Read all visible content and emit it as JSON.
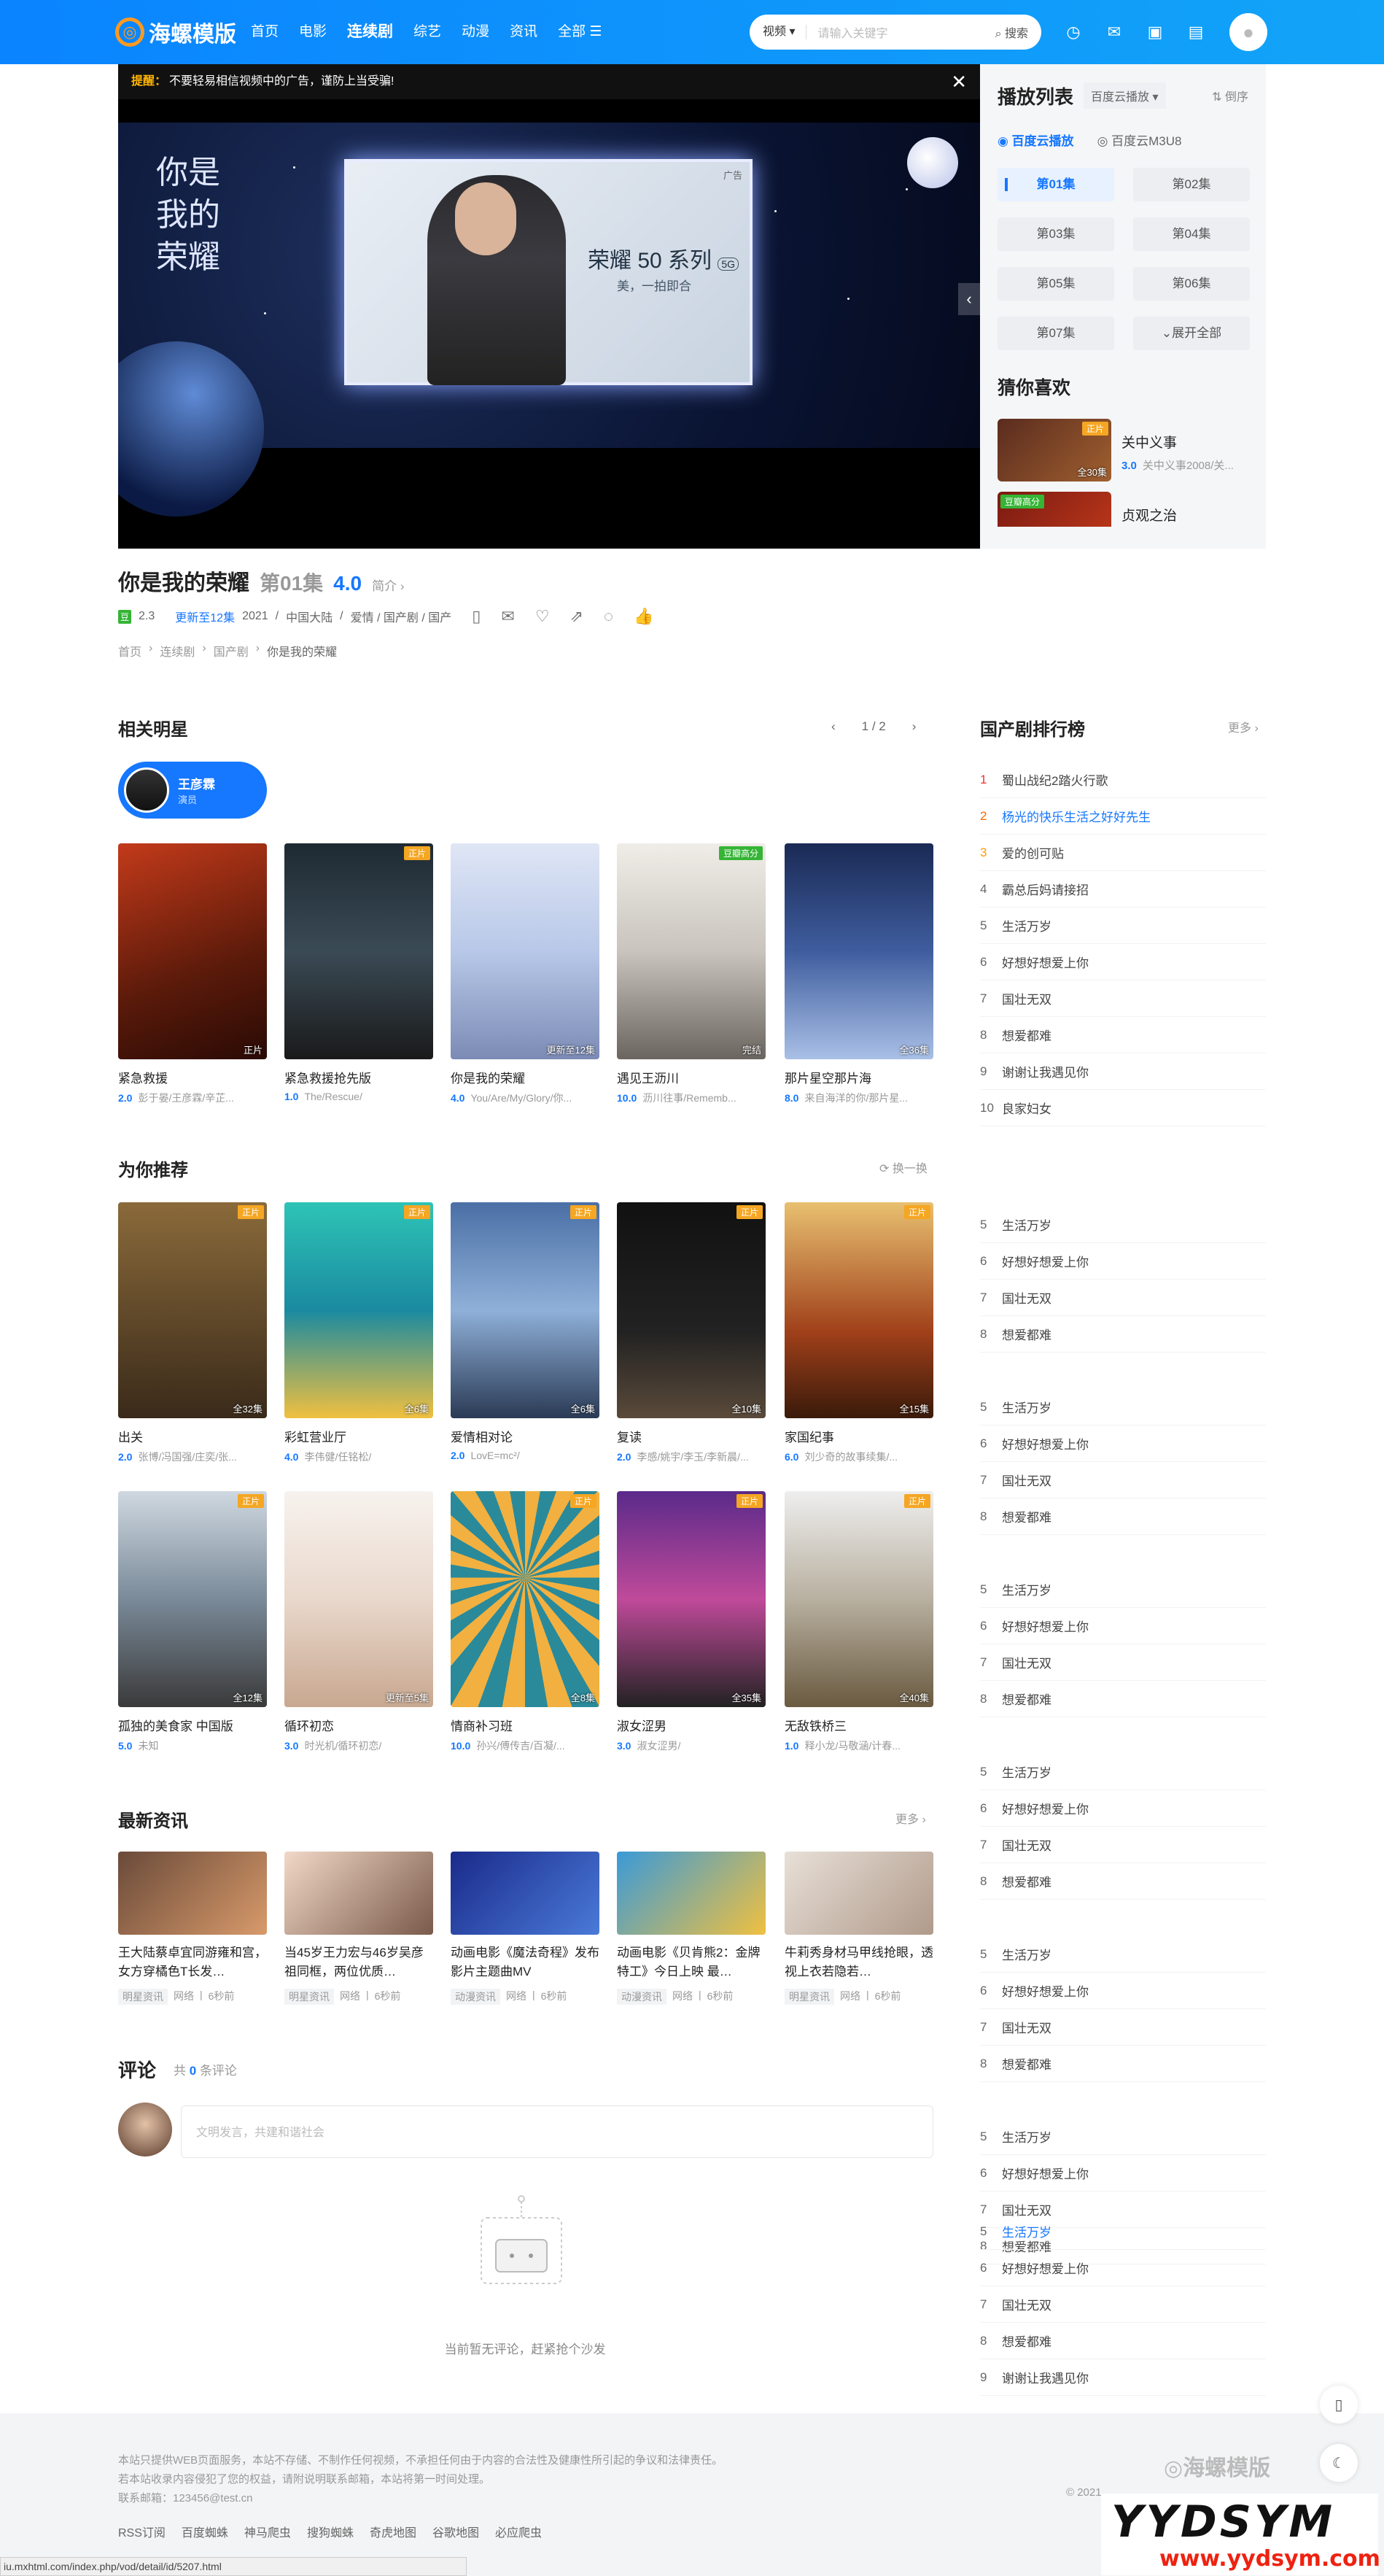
{
  "header": {
    "logo": "海螺模版",
    "nav": [
      "首页",
      "电影",
      "连续剧",
      "综艺",
      "动漫",
      "资讯",
      "全部 ☰"
    ],
    "active_nav": "连续剧",
    "search": {
      "type": "视频",
      "placeholder": "请输入关键字",
      "button": "搜索"
    }
  },
  "player": {
    "tip_label": "提醒：",
    "tip_text": "不要轻易相信视频中的广告，谨防上当受骗!",
    "ad": {
      "calligraphy": "你是我的荣耀",
      "product": "荣耀 50 系列",
      "badge5g": "5G",
      "slogan": "美，一拍即合",
      "ad_tag": "广告"
    }
  },
  "playlist": {
    "title": "播放列表",
    "source_select": "百度云播放",
    "order": "倒序",
    "sources": [
      "百度云播放",
      "百度云M3U8"
    ],
    "episodes": [
      "第01集",
      "第02集",
      "第03集",
      "第04集",
      "第05集",
      "第06集",
      "第07集",
      "展开全部"
    ],
    "current": "第01集",
    "guess_title": "猜你喜欢",
    "guess": [
      {
        "name": "关中义事",
        "score": "3.0",
        "desc": "关中义事2008/关...",
        "badge": "正片",
        "tag": "全30集"
      },
      {
        "name": "贞观之治",
        "score": "",
        "desc": "",
        "badge": "豆瓣高分",
        "tag": ""
      }
    ]
  },
  "info": {
    "title": "你是我的荣耀",
    "episode": "第01集",
    "score": "4.0",
    "intro": "简介",
    "douban": "2.3",
    "update": "更新至12集",
    "year": "2021",
    "region": "中国大陆",
    "genres": "爱情 / 国产剧 / 国产",
    "breadcrumb": [
      "首页",
      "连续剧",
      "国产剧",
      "你是我的荣耀"
    ]
  },
  "stars": {
    "title": "相关明星",
    "pager": "1 / 2",
    "chip": {
      "name": "王彦霖",
      "role": "演员"
    },
    "cards": [
      {
        "name": "紧急救援",
        "score": "2.0",
        "cast": "彭于晏/王彦霖/辛芷...",
        "badge": "",
        "tag": "正片"
      },
      {
        "name": "紧急救援抢先版",
        "score": "1.0",
        "cast": "The/Rescue/",
        "badge": "正片",
        "tag": ""
      },
      {
        "name": "你是我的荣耀",
        "score": "4.0",
        "cast": "You/Are/My/Glory/你...",
        "badge": "",
        "tag": "更新至12集"
      },
      {
        "name": "遇见王沥川",
        "score": "10.0",
        "cast": "沥川往事/Rememb...",
        "badge": "豆瓣高分",
        "tag": "完结"
      },
      {
        "name": "那片星空那片海",
        "score": "8.0",
        "cast": "来自海洋的你/那片星...",
        "badge": "",
        "tag": "全36集"
      }
    ]
  },
  "recommend": {
    "title": "为你推荐",
    "refresh": "换一换",
    "cards": [
      {
        "name": "出关",
        "score": "2.0",
        "cast": "张博/冯国强/庄奕/张...",
        "badge": "正片",
        "tag": "全32集"
      },
      {
        "name": "彩虹营业厅",
        "score": "4.0",
        "cast": "李伟健/任铭松/",
        "badge": "正片",
        "tag": "全6集"
      },
      {
        "name": "爱情相对论",
        "score": "2.0",
        "cast": "LovE=mc²/",
        "badge": "正片",
        "tag": "全6集"
      },
      {
        "name": "复读",
        "score": "2.0",
        "cast": "李感/姚宇/李玉/李新晨/...",
        "badge": "正片",
        "tag": "全10集"
      },
      {
        "name": "家国纪事",
        "score": "6.0",
        "cast": "刘少奇的故事续集/...",
        "badge": "正片",
        "tag": "全15集"
      },
      {
        "name": "孤独的美食家 中国版",
        "score": "5.0",
        "cast": "未知",
        "badge": "正片",
        "tag": "全12集"
      },
      {
        "name": "循环初恋",
        "score": "3.0",
        "cast": "时光机/循环初恋/",
        "badge": "",
        "tag": "更新至5集"
      },
      {
        "name": "情商补习班",
        "score": "10.0",
        "cast": "孙兴/傅传吉/百凝/...",
        "badge": "正片",
        "tag": "全8集"
      },
      {
        "name": "淑女涩男",
        "score": "3.0",
        "cast": "淑女涩男/",
        "badge": "正片",
        "tag": "全35集"
      },
      {
        "name": "无敌铁桥三",
        "score": "1.0",
        "cast": "释小龙/马敬涵/计春...",
        "badge": "正片",
        "tag": "全40集"
      }
    ]
  },
  "rank": {
    "title": "国产剧排行榜",
    "more": "更多",
    "items": [
      "蜀山战纪2踏火行歌",
      "杨光的快乐生活之好好先生",
      "爱的创可贴",
      "霸总后妈请接招",
      "生活万岁",
      "好想好想爱上你",
      "国壮无双",
      "想爱都难",
      "谢谢让我遇见你",
      "良家妇女"
    ],
    "repeat_items": [
      "生活万岁",
      "好想好想爱上你",
      "国壮无双",
      "想爱都难",
      "谢谢让我遇见你"
    ]
  },
  "news": {
    "title": "最新资讯",
    "more": "更多",
    "items": [
      {
        "title": "王大陆蔡卓宜同游雍和宫，女方穿橘色T长发…",
        "cat": "明星资讯",
        "src": "网络",
        "time": "6秒前"
      },
      {
        "title": "当45岁王力宏与46岁吴彦祖同框，两位优质…",
        "cat": "明星资讯",
        "src": "网络",
        "time": "6秒前"
      },
      {
        "title": "动画电影《魔法奇程》发布影片主题曲MV",
        "cat": "动漫资讯",
        "src": "网络",
        "time": "6秒前"
      },
      {
        "title": "动画电影《贝肯熊2：金牌特工》今日上映 最…",
        "cat": "动漫资讯",
        "src": "网络",
        "time": "6秒前"
      },
      {
        "title": "牛莉秀身材马甲线抢眼，透视上衣若隐若…",
        "cat": "明星资讯",
        "src": "网络",
        "time": "6秒前"
      }
    ]
  },
  "comments": {
    "title": "评论",
    "count_pre": "共",
    "count": "0",
    "count_post": "条评论",
    "placeholder": "文明发言，共建和谐社会",
    "empty": "当前暂无评论，赶紧抢个沙发"
  },
  "footer": {
    "line1": "本站只提供WEB页面服务，本站不存储、不制作任何视频，不承担任何由于内容的合法性及健康性所引起的争议和法律责任。",
    "line2": "若本站收录内容侵犯了您的权益，请附说明联系邮箱，本站将第一时间处理。",
    "line3": "联系邮箱：123456@test.cn",
    "links": [
      "RSS订阅",
      "百度蜘蛛",
      "神马爬虫",
      "搜狗蜘蛛",
      "奇虎地图",
      "谷歌地图",
      "必应爬虫"
    ],
    "logo": "海螺模版",
    "copy": "© 2021"
  },
  "status_url": "iu.mxhtml.com/index.php/vod/detail/id/5207.html",
  "watermark": {
    "big": "YYDSYM",
    "small": "www.yydsym.com"
  }
}
